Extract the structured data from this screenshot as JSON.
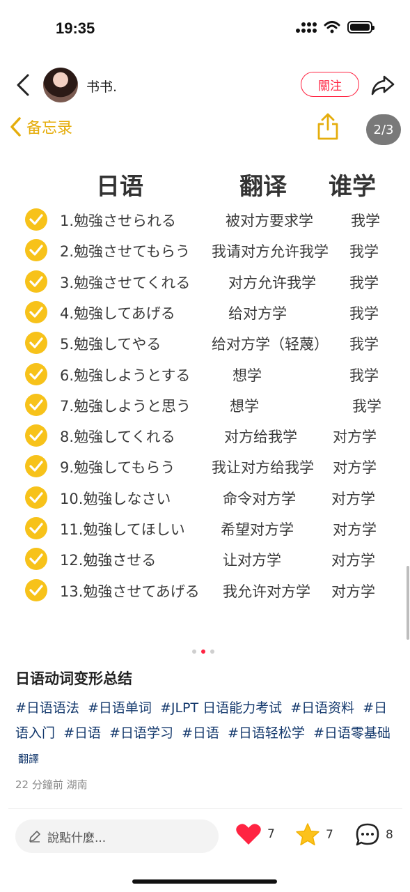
{
  "status_bar": {
    "time": "19:35"
  },
  "header": {
    "author": "书书.",
    "follow_label": "關注"
  },
  "note_image": {
    "back_label": "备忘录",
    "page_indicator": "2/3",
    "column_headers": [
      "日语",
      "翻译",
      "谁学"
    ],
    "rows": [
      {
        "jp": "1.勉強させられる",
        "cn": "被对方要求学",
        "who": "我学"
      },
      {
        "jp": "2.勉強させてもらう",
        "cn": "我请对方允许我学",
        "who": "我学"
      },
      {
        "jp": "3.勉強させてくれる",
        "cn": "对方允许我学",
        "who": "我学"
      },
      {
        "jp": "4.勉強してあげる",
        "cn": "给对方学",
        "who": "我学"
      },
      {
        "jp": "5.勉強してやる",
        "cn": "给对方学（轻蔑）",
        "who": "我学"
      },
      {
        "jp": "6.勉強しようとする",
        "cn": "想学",
        "who": "我学"
      },
      {
        "jp": "7.勉強しようと思う",
        "cn": "想学",
        "who": "我学"
      },
      {
        "jp": "8.勉強してくれる",
        "cn": "对方给我学",
        "who": "对方学"
      },
      {
        "jp": "9.勉強してもらう",
        "cn": "我让对方给我学",
        "who": "对方学"
      },
      {
        "jp": "10.勉強しなさい",
        "cn": "命令对方学",
        "who": "对方学"
      },
      {
        "jp": "11.勉強してほしい",
        "cn": "希望对方学",
        "who": "对方学"
      },
      {
        "jp": "12.勉強させる",
        "cn": "让对方学",
        "who": "对方学"
      },
      {
        "jp": "13.勉強させてあげる",
        "cn": "我允许对方学",
        "who": "对方学"
      }
    ],
    "carousel": {
      "total": 3,
      "current": 2
    }
  },
  "post": {
    "title": "日语动词变形总结",
    "tags": [
      "#日语语法",
      "#日语单词",
      "#JLPT 日语能力考试",
      "#日语资料",
      "#日语入门",
      "#日语",
      "#日语学习",
      "#日语",
      "#日语轻松学",
      "#日语零基础"
    ],
    "translate_label": "翻譯",
    "meta": "22 分鐘前 湖南"
  },
  "bottom_bar": {
    "comment_placeholder": "說點什麼...",
    "likes": "7",
    "stars": "7",
    "comments": "8"
  },
  "colors": {
    "accent_red": "#ff2442",
    "memo_yellow": "#e5ad0c",
    "check_yellow": "#f7c21a",
    "tag_blue": "#13386c"
  },
  "icons": [
    "back-icon",
    "share-icon",
    "memo-share-icon",
    "check-icon",
    "pencil-icon",
    "heart-icon",
    "star-icon",
    "comment-icon",
    "wifi-icon",
    "signal-icon",
    "battery-icon"
  ]
}
